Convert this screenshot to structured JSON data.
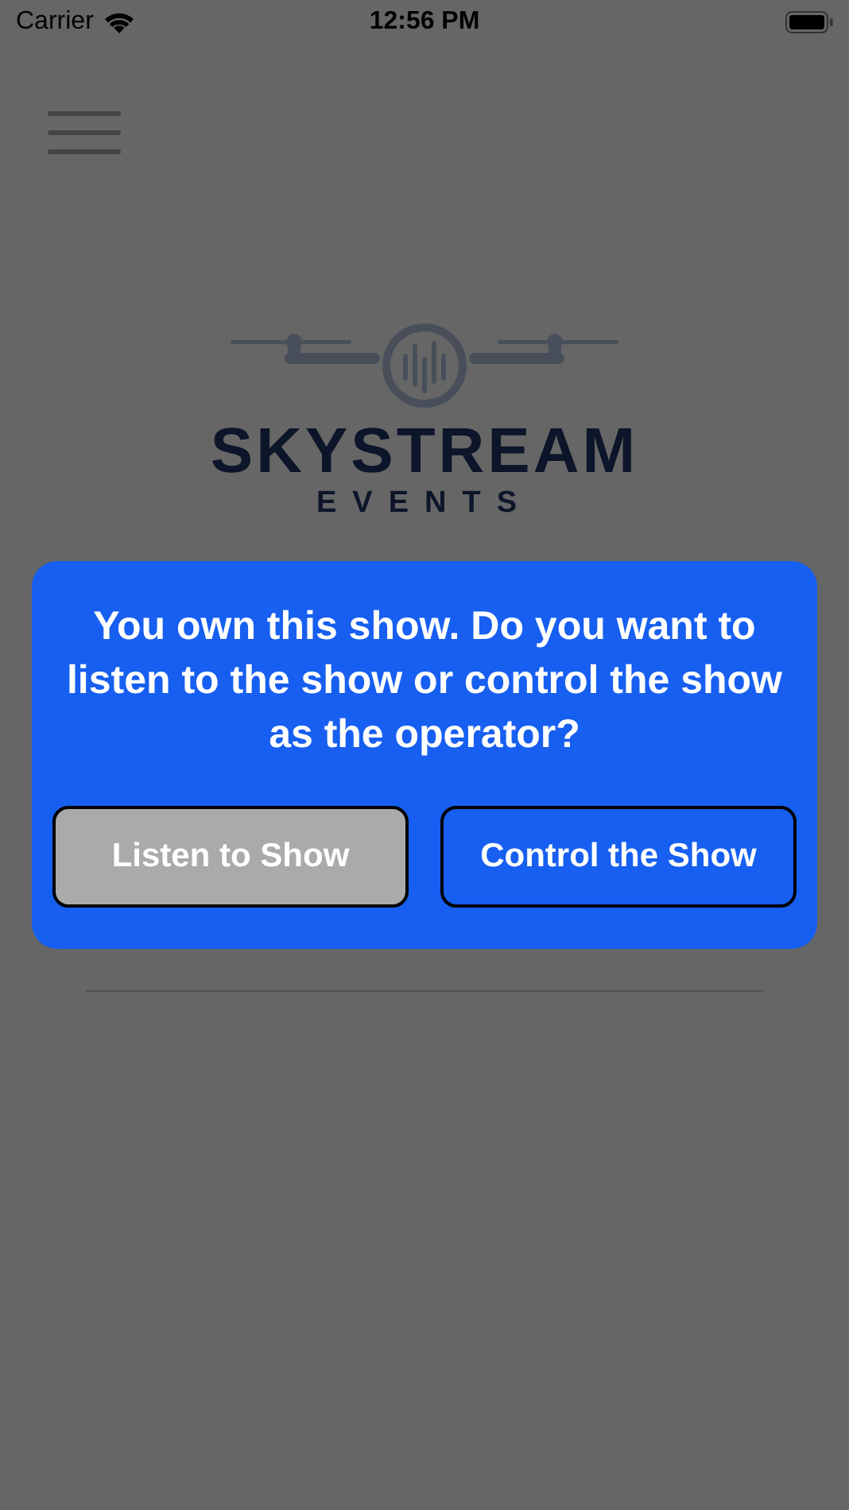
{
  "status_bar": {
    "carrier": "Carrier",
    "time": "12:56 PM"
  },
  "logo": {
    "title": "SKYSTREAM",
    "subtitle": "EVENTS"
  },
  "dialog": {
    "message": "You own this show. Do you want to listen to the show or control the show as the operator?",
    "buttons": [
      {
        "label": "Listen to Show",
        "kind": "secondary"
      },
      {
        "label": "Control the Show",
        "kind": "primary"
      }
    ]
  }
}
